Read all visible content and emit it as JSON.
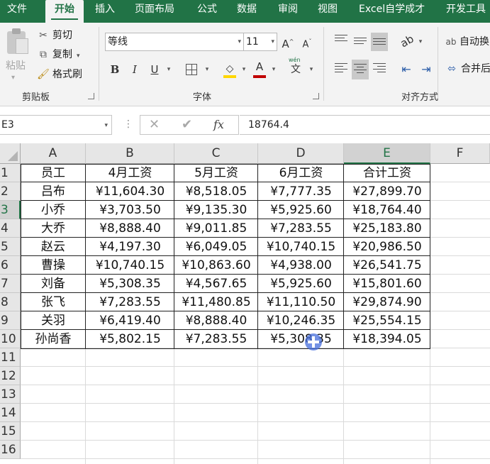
{
  "tabs": [
    "文件",
    "开始",
    "插入",
    "页面布局",
    "公式",
    "数据",
    "审阅",
    "视图",
    "Excel自学成才",
    "开发工具"
  ],
  "ribbon": {
    "clipboard": {
      "paste": "粘贴",
      "cut": "剪切",
      "copy": "复制",
      "format_painter": "格式刷",
      "group_label": "剪贴板"
    },
    "font": {
      "font_name": "等线",
      "font_size": "11",
      "bold": "B",
      "italic": "I",
      "underline": "U",
      "font_color_glyph": "A",
      "grow": "A",
      "shrink": "A",
      "phonetic": "文",
      "phonetic_top": "wén",
      "group_label": "字体"
    },
    "alignment": {
      "wrap_text": "自动换",
      "merge_center": "合并后",
      "group_label": "对齐方式"
    }
  },
  "formula_bar": {
    "name_box": "E3",
    "cancel": "✕",
    "enter": "✔",
    "fx": "fx",
    "content": "18764.4"
  },
  "columns": [
    "A",
    "B",
    "C",
    "D",
    "E",
    "F"
  ],
  "rows": [
    "1",
    "2",
    "3",
    "4",
    "5",
    "6",
    "7",
    "8",
    "9",
    "10",
    "11",
    "12",
    "13",
    "14",
    "15",
    "16"
  ],
  "table": {
    "headers": [
      "员工",
      "4月工资",
      "5月工资",
      "6月工资",
      "合计工资"
    ],
    "rows": [
      [
        "吕布",
        "¥11,604.30",
        "¥8,518.05",
        "¥7,777.35",
        "¥27,899.70"
      ],
      [
        "小乔",
        "¥3,703.50",
        "¥9,135.30",
        "¥5,925.60",
        "¥18,764.40"
      ],
      [
        "大乔",
        "¥8,888.40",
        "¥9,011.85",
        "¥7,283.55",
        "¥25,183.80"
      ],
      [
        "赵云",
        "¥4,197.30",
        "¥6,049.05",
        "¥10,740.15",
        "¥20,986.50"
      ],
      [
        "曹操",
        "¥10,740.15",
        "¥10,863.60",
        "¥4,938.00",
        "¥26,541.75"
      ],
      [
        "刘备",
        "¥5,308.35",
        "¥4,567.65",
        "¥5,925.60",
        "¥15,801.60"
      ],
      [
        "张飞",
        "¥7,283.55",
        "¥11,480.85",
        "¥11,110.50",
        "¥29,874.90"
      ],
      [
        "关羽",
        "¥6,419.40",
        "¥8,888.40",
        "¥10,246.35",
        "¥25,554.15"
      ],
      [
        "孙尚香",
        "¥5,802.15",
        "¥7,283.55",
        "¥5,308.35",
        "¥18,394.05"
      ]
    ]
  },
  "colors": {
    "excel_green": "#217346",
    "header_gray": "#e6e6e6",
    "cursor_blue": "#466edc"
  }
}
